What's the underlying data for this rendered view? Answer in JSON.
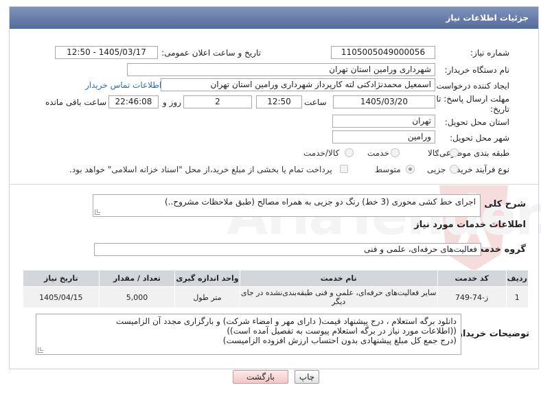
{
  "header": {
    "title": "جزئیات اطلاعات نیاز"
  },
  "fields": {
    "need_number_label": "شماره نیاز:",
    "need_number": "1105005049000056",
    "announce_label": "تاریخ و ساعت اعلان عمومی:",
    "announce_value": "1405/03/17 - 12:50",
    "buyer_org_label": "نام دستگاه خریدار:",
    "buyer_org": "شهرداری ورامین استان تهران",
    "requester_label": "ایجاد کننده درخواست:",
    "requester": "اسمعیل محمدنژادکتی لته کارپرداز شهرداری ورامین استان تهران",
    "contact_link": "اطلاعات تماس خریدار",
    "deadline_label_1": "مهلت ارسال پاسخ: تا",
    "deadline_label_2": "تاریخ:",
    "deadline_date": "1405/03/20",
    "time_label": "ساعت",
    "deadline_time": "12:50",
    "days_value": "2",
    "days_label": "روز و",
    "remaining_time": "22:46:08",
    "remaining_label": "ساعت باقی مانده",
    "province_label": "استان محل تحویل:",
    "province": "تهران",
    "city_label": "شهر محل تحویل:",
    "city": "ورامین",
    "category_label": "طبقه بندی موضوعی:",
    "category_options": {
      "goods": "کالا",
      "service": "خدمت",
      "goods_service": "کالا/خدمت"
    },
    "process_label": "نوع فرآیند خرید :",
    "process_options": {
      "partial": "جزیی",
      "medium": "متوسط"
    },
    "payment_note": "پرداخت تمام یا بخشی از مبلغ خرید،از محل \"اسناد خزانه اسلامی\" خواهد بود."
  },
  "description": {
    "label": "شرح کلی نیاز:",
    "text": "اجرای خط کشی محوری (3 خط) رنگ دو جزیی به همراه مصالح (طبق ملاحظات مشروح..)"
  },
  "services": {
    "section_title": "اطلاعات خدمات مورد نیاز",
    "group_label": "گروه خدمت:",
    "group_value": "فعالیت‌های حرفه‌ای، علمی و فنی",
    "columns": [
      "ردیف",
      "کد خدمت",
      "نام خدمت",
      "واحد اندازه گیری",
      "تعداد / مقدار",
      "تاریخ نیاز"
    ],
    "rows": [
      {
        "row": "1",
        "code": "ز-74-749",
        "name": "سایر فعالیت‌های حرفه‌ای، علمی و فنی طبقه‌بندی‌نشده در جای دیگر",
        "unit": "متر طول",
        "qty": "5,000",
        "date": "1405/04/15"
      }
    ]
  },
  "buyer_notes": {
    "label": "توضیحات خریدار:",
    "line1": "دانلود برگه استعلام ، درج پیشنهاد قیمت( دارای مهر و امضاء شرکت) و بارگزاری مجدد آن الزامیست",
    "line2": "((اطلاعات مورد نیاز در برگه استعلام پیوست به تفصیل آمده است))",
    "line3": "(درج  جمع کل مبلغ پیشنهادی بدون احتساب ارزش افزوده الزامیست)"
  },
  "buttons": {
    "print": "چاپ",
    "back": "بازگشت"
  }
}
